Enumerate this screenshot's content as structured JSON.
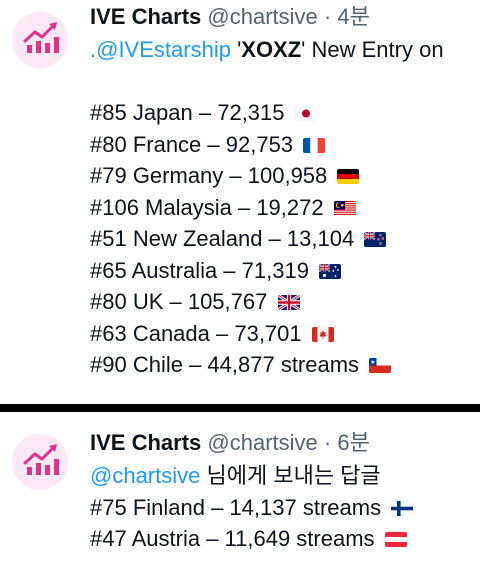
{
  "tweets": [
    {
      "account": {
        "name": "IVE Charts",
        "handle": "@chartsive",
        "separator": "·",
        "time": "4분"
      },
      "mention": ".@IVEstarship",
      "song": "XOXZ",
      "intro_rest": "New Entry on",
      "entries": [
        {
          "text": "#85 Japan – 72,315",
          "flag": "japan-flag"
        },
        {
          "text": "#80 France – 92,753",
          "flag": "france-flag"
        },
        {
          "text": "#79 Germany – 100,958",
          "flag": "germany-flag"
        },
        {
          "text": "#106 Malaysia – 19,272",
          "flag": "malaysia-flag"
        },
        {
          "text": "#51 New Zealand – 13,104",
          "flag": "new-zealand-flag"
        },
        {
          "text": "#65 Australia – 71,319",
          "flag": "australia-flag"
        },
        {
          "text": "#80 UK – 105,767",
          "flag": "uk-flag"
        },
        {
          "text": "#63 Canada – 73,701",
          "flag": "canada-flag"
        },
        {
          "text": "#90 Chile – 44,877 streams",
          "flag": "chile-flag"
        }
      ]
    },
    {
      "account": {
        "name": "IVE Charts",
        "handle": "@chartsive",
        "separator": "·",
        "time": "6분"
      },
      "reply_handle": "@chartsive",
      "reply_text": "님에게 보내는 답글",
      "entries": [
        {
          "text": "#75 Finland – 14,137 streams",
          "flag": "finland-flag"
        },
        {
          "text": "#47 Austria – 11,649 streams",
          "flag": "austria-flag"
        }
      ]
    }
  ],
  "colors": {
    "avatar_bg": "#fde8f6",
    "avatar_icon": "#e0318c",
    "link": "#1d9bf0",
    "muted": "#536471",
    "text": "#0f1419",
    "divider": "#000000"
  }
}
